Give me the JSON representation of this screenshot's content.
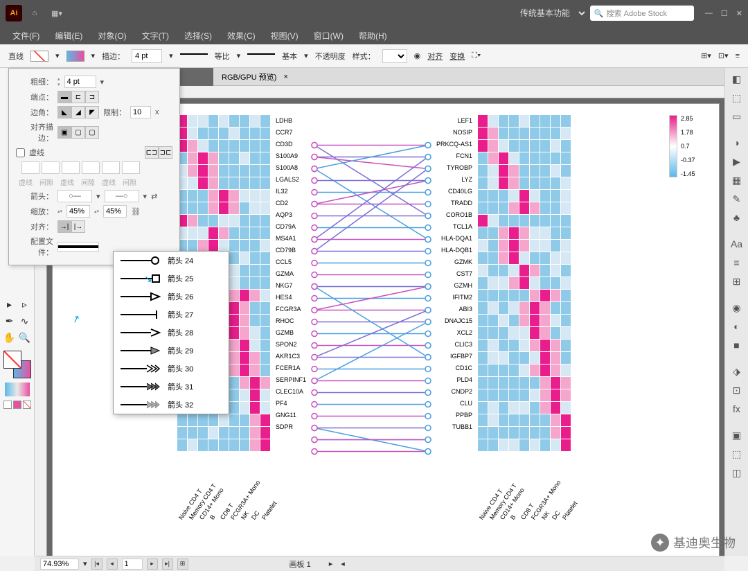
{
  "titlebar": {
    "workspace": "传统基本功能",
    "search_placeholder": "搜索 Adobe Stock"
  },
  "menu": [
    "文件(F)",
    "编辑(E)",
    "对象(O)",
    "文字(T)",
    "选择(S)",
    "效果(C)",
    "视图(V)",
    "窗口(W)",
    "帮助(H)"
  ],
  "ctrlbar": {
    "tool": "直线",
    "stroke_label": "描边：",
    "stroke_pt": "4 pt",
    "uniform": "等比",
    "basic": "基本",
    "opacity": "不透明度",
    "style": "样式：",
    "align": "对齐",
    "transform": "变换"
  },
  "doc_tab": "RGB/GPU 预览)",
  "stroke_panel": {
    "weight_label": "粗细：",
    "weight": "4 pt",
    "cap_label": "端点：",
    "corner_label": "边角：",
    "limit_label": "限制：",
    "limit": "10",
    "limit_x": "x",
    "align_label": "对齐描边：",
    "dash_label": "虚线",
    "dash_cols": [
      "虚线",
      "间隙",
      "虚线",
      "间隙",
      "虚线",
      "间隙"
    ],
    "arrow_label": "箭头：",
    "scale_label": "缩放：",
    "scale1": "45%",
    "scale2": "45%",
    "align2_label": "对齐：",
    "profile_label": "配置文件："
  },
  "arrow_menu": [
    {
      "label": "箭头 24"
    },
    {
      "label": "箭头 25"
    },
    {
      "label": "箭头 26"
    },
    {
      "label": "箭头 27"
    },
    {
      "label": "箭头 28"
    },
    {
      "label": "箭头 29"
    },
    {
      "label": "箭头 30"
    },
    {
      "label": "箭头 31"
    },
    {
      "label": "箭头 32"
    }
  ],
  "statusbar": {
    "zoom": "74.93%",
    "artboard_nav": "1",
    "artboard_label": "画板 1"
  },
  "watermark": "基迪奥生物",
  "chart_data": {
    "type": "heatmap",
    "x_categories": [
      "Naive CD4 T",
      "Memory CD4 T",
      "CD14+ Mono",
      "B",
      "CD8 T",
      "FCGR3A+ Mono",
      "NK",
      "DC",
      "Platelet"
    ],
    "genes_left": [
      "LDHB",
      "CCR7",
      "CD3D",
      "S100A9",
      "S100A8",
      "LGALS2",
      "IL32",
      "CD2",
      "AQP3",
      "CD79A",
      "MS4A1",
      "CD79B",
      "CCL5",
      "GZMA",
      "NKG7",
      "HES4",
      "FCGR3A",
      "RHOC",
      "GZMB",
      "SPON2",
      "AKR1C3",
      "FCER1A",
      "SERPINF1",
      "CLEC10A",
      "PF4",
      "GNG11",
      "SDPR"
    ],
    "genes_right": [
      "LEF1",
      "NOSIP",
      "PRKCQ-AS1",
      "FCN1",
      "TYROBP",
      "LYZ",
      "CD40LG",
      "TRADD",
      "CORO1B",
      "TCL1A",
      "HLA-DQA1",
      "HLA-DQB1",
      "GZMK",
      "CST7",
      "GZMH",
      "IFITM2",
      "ABI3",
      "DNAJC15",
      "XCL2",
      "CLIC3",
      "IGFBP7",
      "CD1C",
      "PLD4",
      "CNDP2",
      "CLU",
      "PPBP",
      "TUBB1"
    ],
    "legend_ticks": [
      "2.85",
      "1.78",
      "0.7",
      "-0.37",
      "-1.45"
    ],
    "left_matrix_high_cols": [
      0,
      0,
      0,
      2,
      2,
      2,
      4,
      4,
      0,
      3,
      3,
      3,
      4,
      4,
      6,
      5,
      5,
      5,
      6,
      6,
      6,
      7,
      7,
      7,
      8,
      8,
      8
    ],
    "connections": [
      [
        0,
        0
      ],
      [
        1,
        1
      ],
      [
        2,
        8
      ],
      [
        1,
        2
      ],
      [
        3,
        3
      ],
      [
        4,
        4
      ],
      [
        5,
        5
      ],
      [
        6,
        6
      ],
      [
        7,
        7
      ],
      [
        8,
        8
      ],
      [
        9,
        9
      ],
      [
        10,
        10
      ],
      [
        11,
        11
      ],
      [
        12,
        12
      ],
      [
        13,
        13
      ],
      [
        14,
        14
      ],
      [
        15,
        15
      ],
      [
        16,
        16
      ],
      [
        17,
        17
      ],
      [
        18,
        18
      ],
      [
        19,
        19
      ],
      [
        20,
        20
      ],
      [
        21,
        21
      ],
      [
        22,
        22
      ],
      [
        23,
        23
      ],
      [
        24,
        24
      ],
      [
        25,
        25
      ],
      [
        26,
        26
      ],
      [
        0,
        6
      ],
      [
        2,
        0
      ],
      [
        5,
        3
      ],
      [
        8,
        1
      ],
      [
        12,
        18
      ],
      [
        14,
        12
      ],
      [
        18,
        14
      ],
      [
        24,
        26
      ],
      [
        25,
        25
      ],
      [
        9,
        2
      ],
      [
        20,
        15
      ]
    ]
  }
}
